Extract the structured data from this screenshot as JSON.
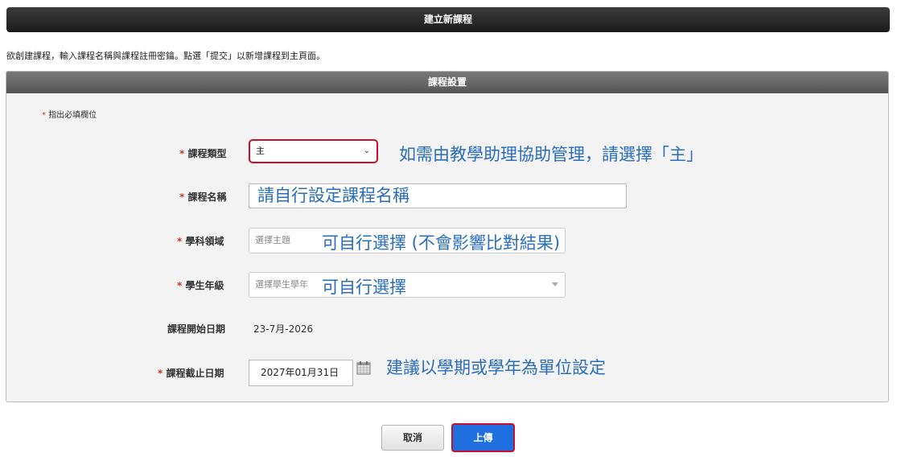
{
  "page": {
    "title": "建立新課程"
  },
  "intro_text": "欲創建課程，輸入課程名稱與課程註冊密鑰。點選「提交」以新增課程到主頁面。",
  "panel": {
    "title": "課程設置",
    "required_note": "指出必填欄位"
  },
  "form": {
    "course_type": {
      "label": "課程類型",
      "value": "主",
      "annotation": "如需由教學助理協助管理，請選擇「主」"
    },
    "course_name": {
      "label": "課程名稱",
      "value": "請自行設定課程名稱"
    },
    "subject_area": {
      "label": "學科領域",
      "placeholder": "選擇主題",
      "annotation": "可自行選擇 (不會影響比對結果)"
    },
    "student_grade": {
      "label": "學生年級",
      "placeholder": "選擇學生學年",
      "annotation": "可自行選擇"
    },
    "start_date": {
      "label": "課程開始日期",
      "value": "23-7月-2026"
    },
    "end_date": {
      "label": "課程截止日期",
      "value": "2027年01月31日",
      "annotation": "建議以學期或學年為單位設定"
    }
  },
  "buttons": {
    "cancel": "取消",
    "upload": "上傳"
  },
  "icons": {
    "calendar": "calendar-icon",
    "dropdown": "chevron-down-icon"
  },
  "colors": {
    "required": "#c0392b",
    "highlight_border": "#c8102e",
    "annotation": "#2a6ebb",
    "primary": "#1f6fe0"
  }
}
